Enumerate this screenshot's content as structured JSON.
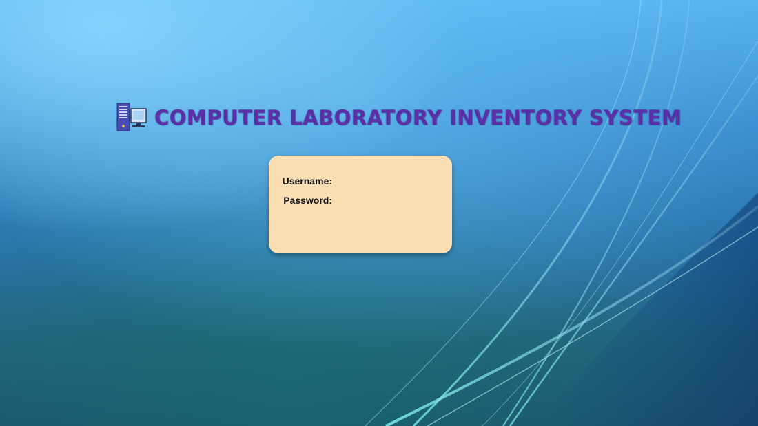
{
  "window": {
    "title": "COMPUTER LABORATORY INVENTORY SYSTEM",
    "icon": "computer-tower-icon"
  },
  "login": {
    "username_label": "Username:",
    "password_label": "Password:",
    "username_value": "",
    "password_value": ""
  },
  "colors": {
    "title": "#5a2fa8",
    "card_background": "#f9deb3"
  }
}
